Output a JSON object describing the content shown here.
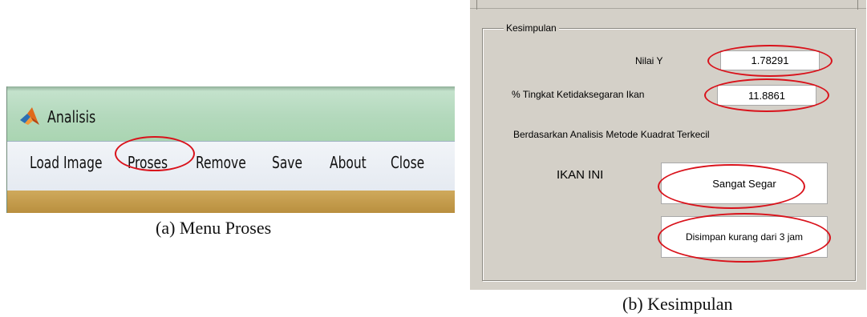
{
  "panel_a": {
    "window_title": "Analisis",
    "menu": [
      "Load Image",
      "Proses",
      "Remove",
      "Save",
      "About",
      "Close"
    ],
    "highlighted_item": "Proses",
    "caption": "(a)  Menu Proses"
  },
  "panel_b": {
    "group_title": "Kesimpulan",
    "nilai_y_label": "Nilai Y",
    "nilai_y_value": "1.78291",
    "tingkat_label": "% Tingkat Ketidaksegaran Ikan",
    "tingkat_value": "11.8861",
    "method_text": "Berdasarkan Analisis Metode Kuadrat Terkecil",
    "ikan_label": "IKAN INI",
    "status_value": "Sangat Segar",
    "storage_value": "Disimpan kurang dari 3 jam",
    "caption": "(b)  Kesimpulan"
  },
  "colors": {
    "highlight": "#d9121b",
    "titlebar": "#b4d9bd",
    "menubar": "#e8ecf2",
    "gui_background": "#d4d0c8"
  },
  "icons": {
    "app": "matlab-logo-icon"
  }
}
